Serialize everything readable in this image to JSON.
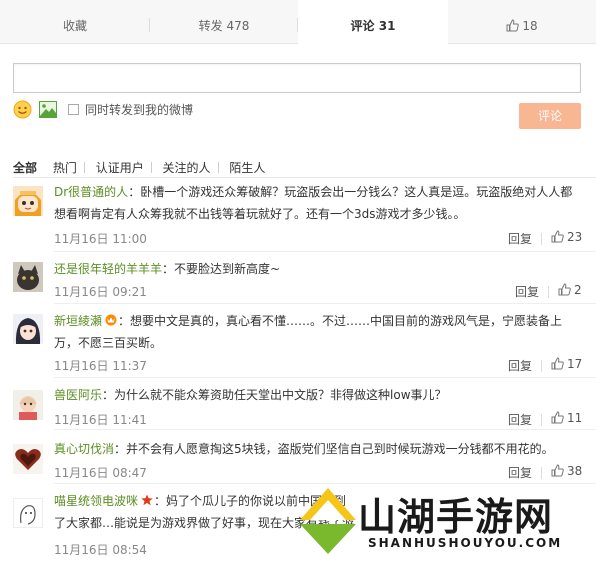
{
  "tabs": {
    "favorite": "收藏",
    "repost": "转发 478",
    "comment": "评论 31",
    "like": "18"
  },
  "composer": {
    "input_value": "",
    "emoji_icon": "emoji-icon",
    "picture_icon": "picture-icon",
    "repost_checkbox_label": "同时转发到我的微博",
    "submit_label": "评论"
  },
  "filters": [
    "全部",
    "热门",
    "认证用户",
    "关注的人",
    "陌生人"
  ],
  "comments": [
    {
      "name": "Dr很普通的人",
      "text": "：卧槽一个游戏还众筹破解？玩盗版会出一分钱么？这人真是逗。玩盗版绝对人人都想看啊肯定有人众筹我就不出钱等着玩就好了。还有一个3ds游戏才多少钱。。",
      "time": "11月16日 11:00",
      "reply": "回复",
      "likes": "23"
    },
    {
      "name": "还是很年轻的羊羊羊",
      "text": "：不要脸达到新高度~",
      "time": "11月16日 09:21",
      "reply": "回复",
      "likes": "2"
    },
    {
      "name": "新垣綾瀬",
      "text": "：想要中文是真的，真心看不懂……。不过……中国目前的游戏风气是，宁愿装备上万，不愿三百买断。",
      "time": "11月16日 11:37",
      "reply": "回复",
      "likes": "17"
    },
    {
      "name": "兽医阿乐",
      "text": "：为什么就不能众筹资助任天堂出中文版？非得做这种low事儿？",
      "time": "11月16日 11:41",
      "reply": "回复",
      "likes": "11"
    },
    {
      "name": "真心切伐消",
      "text": "：并不会有人愿意掏这5块钱，盗版党们坚信自己到时候玩游戏一分钱都不用花的。",
      "time": "11月16日 08:47",
      "reply": "回复",
      "likes": "38"
    },
    {
      "name": "喵星统领电波咪",
      "text": "：妈了个瓜儿子的你说以前中国玩到了大家都…能说是为游戏界做了好事，现在大家有钱了游戏…了搞破解就直…啊",
      "time": "11月16日 08:54",
      "reply": "",
      "likes": ""
    }
  ],
  "watermark": {
    "title": "山湖手游网",
    "subtitle": "SHANHUSHOUYOU.COM"
  },
  "colors": {
    "accent_green": "#5a8f23",
    "submit_bg": "#f8b693"
  }
}
